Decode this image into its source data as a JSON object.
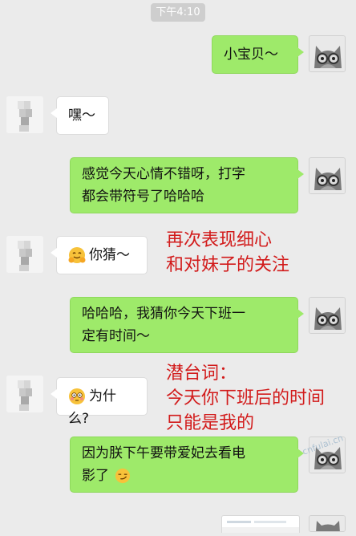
{
  "chat": {
    "timestamp": "下午4:10",
    "messages": [
      {
        "text": "小宝贝～"
      },
      {
        "text": "嘿～"
      },
      {
        "text": "感觉今天心情不错呀，打字都会带符号了哈哈哈",
        "line1": "感觉今天心情不错呀，打字",
        "line2": "都会带符号了哈哈哈"
      },
      {
        "text": "你猜～",
        "emoji": "smiling-face-hands"
      },
      {
        "text": "哈哈哈，我猜你今天下班一定有时间～",
        "line1": "哈哈哈，我猜你今天下班一",
        "line2": "定有时间～"
      },
      {
        "text": "为什么?",
        "emoji": "flushed-face"
      },
      {
        "text": "因为朕下午要带爱妃去看电影了",
        "line1": "因为朕下午要带爱妃去看电",
        "line2": "影了",
        "emoji": "smirk-face"
      }
    ]
  },
  "annotations": [
    {
      "line1": "再次表现细心",
      "line2": "和对妹子的关注"
    },
    {
      "line1": "潜台词：",
      "line2": "今天你下班后的时间",
      "line3": "只能是我的"
    }
  ],
  "watermark": "cnfulai.cn",
  "colors": {
    "bubble_me": "#9eea6a",
    "bubble_other": "#ffffff",
    "annotation": "#d21b1b",
    "background": "#ebebeb"
  }
}
